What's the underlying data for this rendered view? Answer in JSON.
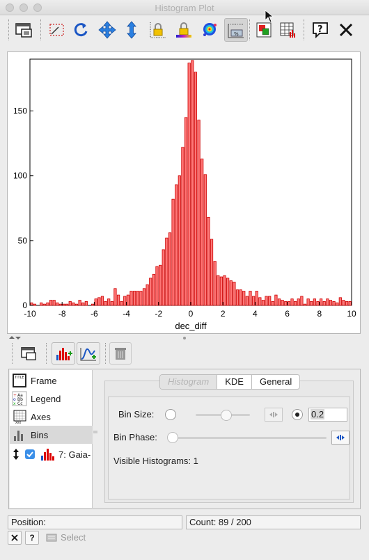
{
  "window": {
    "title": "Histogram Plot"
  },
  "toolbar": {
    "icons": [
      "window-icon",
      "zoom-box-icon",
      "replot-icon",
      "pan-icon",
      "axis-zoom-icon",
      "lock-axes-icon",
      "lock-aux-icon",
      "aux-colormap-icon",
      "weighting-icon",
      "color-picker-icon",
      "export-table-icon",
      "help-icon",
      "close-icon"
    ]
  },
  "chart_data": {
    "type": "bar",
    "title": "",
    "xlabel": "dec_diff",
    "ylabel": "",
    "xlim": [
      -10,
      10
    ],
    "ylim": [
      0,
      190
    ],
    "xticks": [
      -10,
      -8,
      -6,
      -4,
      -2,
      0,
      2,
      4,
      6,
      8,
      10
    ],
    "yticks": [
      0,
      50,
      100,
      150
    ],
    "bin_width": 0.2,
    "x": [
      -9.9,
      -9.7,
      -9.5,
      -9.3,
      -9.1,
      -8.9,
      -8.7,
      -8.5,
      -8.3,
      -8.1,
      -7.9,
      -7.7,
      -7.5,
      -7.3,
      -7.1,
      -6.9,
      -6.7,
      -6.5,
      -6.3,
      -6.1,
      -5.9,
      -5.7,
      -5.5,
      -5.3,
      -5.1,
      -4.9,
      -4.7,
      -4.5,
      -4.3,
      -4.1,
      -3.9,
      -3.7,
      -3.5,
      -3.3,
      -3.1,
      -2.9,
      -2.7,
      -2.5,
      -2.3,
      -2.1,
      -1.9,
      -1.7,
      -1.5,
      -1.3,
      -1.1,
      -0.9,
      -0.7,
      -0.5,
      -0.3,
      -0.1,
      0.1,
      0.3,
      0.5,
      0.7,
      0.9,
      1.1,
      1.3,
      1.5,
      1.7,
      1.9,
      2.1,
      2.3,
      2.5,
      2.7,
      2.9,
      3.1,
      3.3,
      3.5,
      3.7,
      3.9,
      4.1,
      4.3,
      4.5,
      4.7,
      4.9,
      5.1,
      5.3,
      5.5,
      5.7,
      5.9,
      6.1,
      6.3,
      6.5,
      6.7,
      6.9,
      7.1,
      7.3,
      7.5,
      7.7,
      7.9,
      8.1,
      8.3,
      8.5,
      8.7,
      8.9,
      9.1,
      9.3,
      9.5,
      9.7,
      9.9
    ],
    "values": [
      2,
      1,
      0,
      2,
      1,
      2,
      4,
      4,
      2,
      1,
      1,
      1,
      3,
      2,
      1,
      4,
      2,
      3,
      0,
      1,
      5,
      6,
      7,
      3,
      5,
      3,
      13,
      8,
      3,
      7,
      8,
      11,
      11,
      11,
      11,
      13,
      16,
      21,
      24,
      30,
      31,
      43,
      52,
      56,
      82,
      93,
      100,
      122,
      145,
      187,
      189,
      180,
      143,
      113,
      101,
      68,
      51,
      34,
      23,
      22,
      23,
      21,
      19,
      18,
      12,
      12,
      11,
      7,
      11,
      7,
      11,
      6,
      4,
      7,
      7,
      3,
      8,
      5,
      4,
      3,
      3,
      5,
      3,
      5,
      7,
      1,
      5,
      3,
      5,
      3,
      5,
      3,
      5,
      4,
      3,
      2,
      6,
      4,
      3,
      3
    ]
  },
  "controls": {
    "list": [
      {
        "label": "Frame",
        "icon": "frame-icon"
      },
      {
        "label": "Legend",
        "icon": "legend-icon"
      },
      {
        "label": "Axes",
        "icon": "axes-icon"
      },
      {
        "label": "Bins",
        "icon": "bins-icon"
      }
    ],
    "layer": {
      "label": "7: Gaia-",
      "checked": true
    },
    "tabs": [
      "Histogram",
      "KDE",
      "General"
    ],
    "bin_size_label": "Bin Size:",
    "bin_size_value": "0.2",
    "bin_phase_label": "Bin Phase:",
    "visible_histograms": "Visible Histograms: 1"
  },
  "status": {
    "position_label": "Position:",
    "count_label": "Count: 89 / 200",
    "select_label": "Select"
  },
  "colors": {
    "bar_fill": "#ff4a4a",
    "bar_edge": "#cc0000",
    "accent": "#3b8fe8"
  }
}
